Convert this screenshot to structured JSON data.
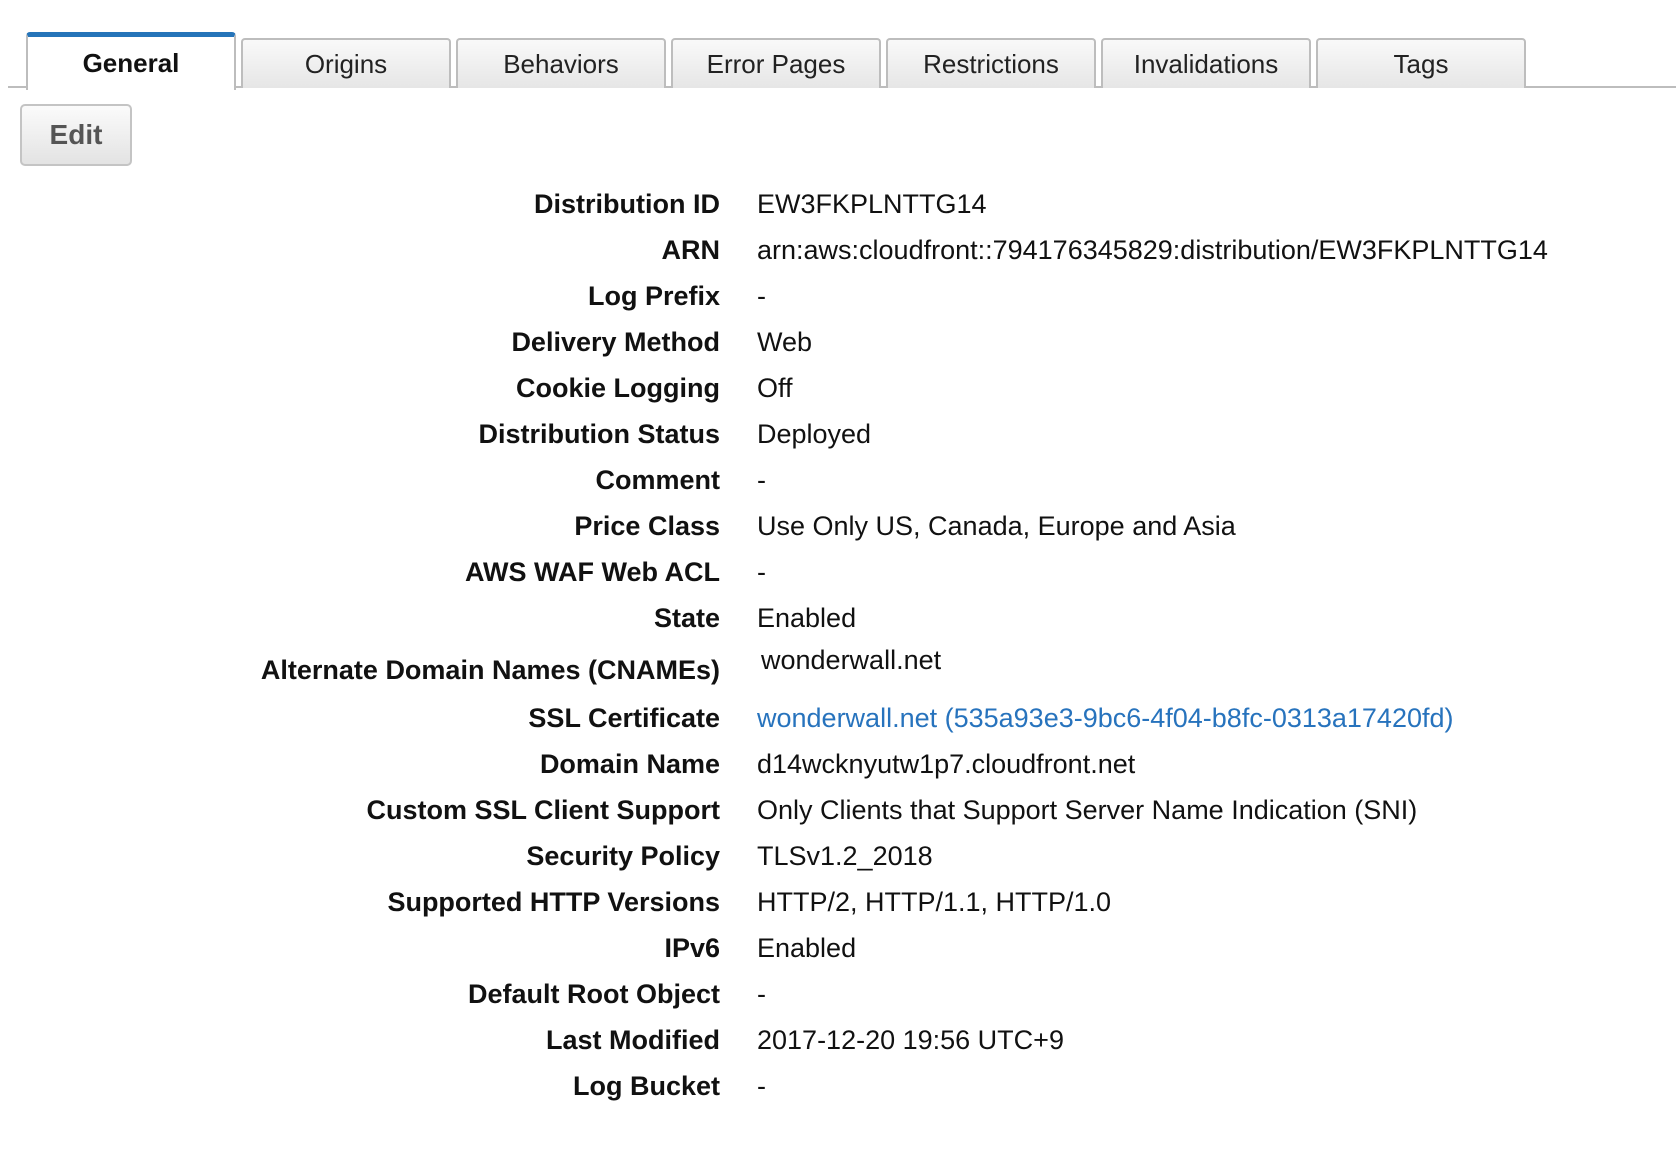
{
  "tabs": [
    {
      "label": "General",
      "active": true
    },
    {
      "label": "Origins",
      "active": false
    },
    {
      "label": "Behaviors",
      "active": false
    },
    {
      "label": "Error Pages",
      "active": false
    },
    {
      "label": "Restrictions",
      "active": false
    },
    {
      "label": "Invalidations",
      "active": false
    },
    {
      "label": "Tags",
      "active": false
    }
  ],
  "toolbar": {
    "edit_label": "Edit"
  },
  "details": {
    "distribution_id": {
      "label": "Distribution ID",
      "value": "EW3FKPLNTTG14"
    },
    "arn": {
      "label": "ARN",
      "value": "arn:aws:cloudfront::794176345829:distribution/EW3FKPLNTTG14"
    },
    "log_prefix": {
      "label": "Log Prefix",
      "value": "-"
    },
    "delivery_method": {
      "label": "Delivery Method",
      "value": "Web"
    },
    "cookie_logging": {
      "label": "Cookie Logging",
      "value": "Off"
    },
    "distribution_status": {
      "label": "Distribution Status",
      "value": "Deployed"
    },
    "comment": {
      "label": "Comment",
      "value": "-"
    },
    "price_class": {
      "label": "Price Class",
      "value": "Use Only US, Canada, Europe and Asia"
    },
    "aws_waf_web_acl": {
      "label": "AWS WAF Web ACL",
      "value": "-"
    },
    "state": {
      "label": "State",
      "value": "Enabled"
    },
    "alternate_domain_names": {
      "label": "Alternate Domain Names (CNAMEs)",
      "value": "wonderwall.net"
    },
    "ssl_certificate": {
      "label": "SSL Certificate",
      "value": "wonderwall.net (535a93e3-9bc6-4f04-b8fc-0313a17420fd)"
    },
    "domain_name": {
      "label": "Domain Name",
      "value": "d14wcknyutw1p7.cloudfront.net"
    },
    "custom_ssl_client_support": {
      "label": "Custom SSL Client Support",
      "value": "Only Clients that Support Server Name Indication (SNI)"
    },
    "security_policy": {
      "label": "Security Policy",
      "value": "TLSv1.2_2018"
    },
    "supported_http_versions": {
      "label": "Supported HTTP Versions",
      "value": "HTTP/2, HTTP/1.1, HTTP/1.0"
    },
    "ipv6": {
      "label": "IPv6",
      "value": "Enabled"
    },
    "default_root_object": {
      "label": "Default Root Object",
      "value": "-"
    },
    "last_modified": {
      "label": "Last Modified",
      "value": "2017-12-20 19:56 UTC+9"
    },
    "log_bucket": {
      "label": "Log Bucket",
      "value": "-"
    }
  },
  "colors": {
    "accent": "#2574b9",
    "link": "#2773bd",
    "border": "#bdbdbd"
  }
}
